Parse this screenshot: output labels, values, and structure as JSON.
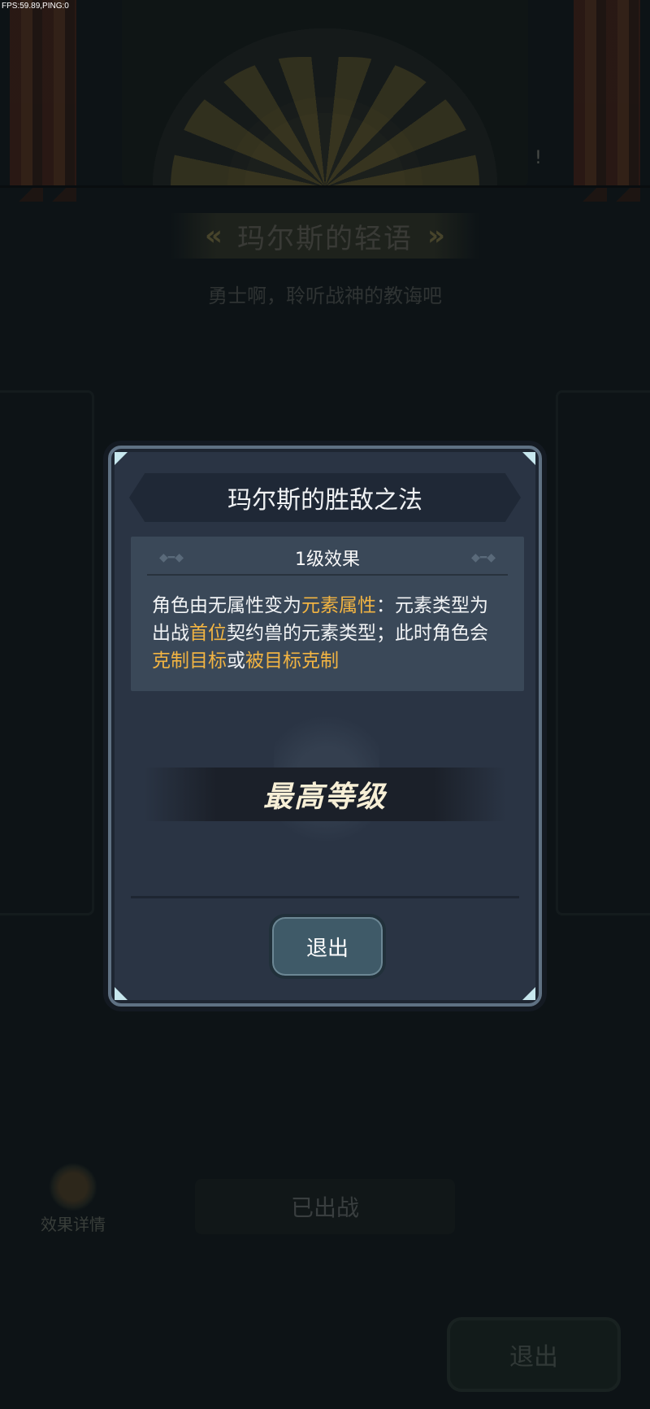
{
  "debug": {
    "fps_text": "FPS:59.89,PING:0"
  },
  "background": {
    "title": "玛尔斯的轻语",
    "subtitle": "勇士啊，聆听战神的教诲吧",
    "exclamation": "!",
    "prev_arrow": "«",
    "next_arrow": "»",
    "effect_details_label": "效果详情",
    "deployed_label": "已出战",
    "exit_label": "退出"
  },
  "modal": {
    "title": "玛尔斯的胜敌之法",
    "effect": {
      "level_label": "1级效果",
      "description": [
        {
          "text": "角色由无属性变为",
          "highlight": false
        },
        {
          "text": "元素属性",
          "highlight": true
        },
        {
          "text": "：元素类型为出战",
          "highlight": false
        },
        {
          "text": "首位",
          "highlight": true
        },
        {
          "text": "契约兽的元素类型；此时角色会",
          "highlight": false
        },
        {
          "text": "克制目标",
          "highlight": true
        },
        {
          "text": "或",
          "highlight": false
        },
        {
          "text": "被目标克制",
          "highlight": true
        }
      ]
    },
    "max_level_label": "最高等级",
    "exit_label": "退出"
  },
  "colors": {
    "highlight": "#f2b442",
    "modal_bg": "#2a3444",
    "panel_bg": "#3a4858"
  }
}
